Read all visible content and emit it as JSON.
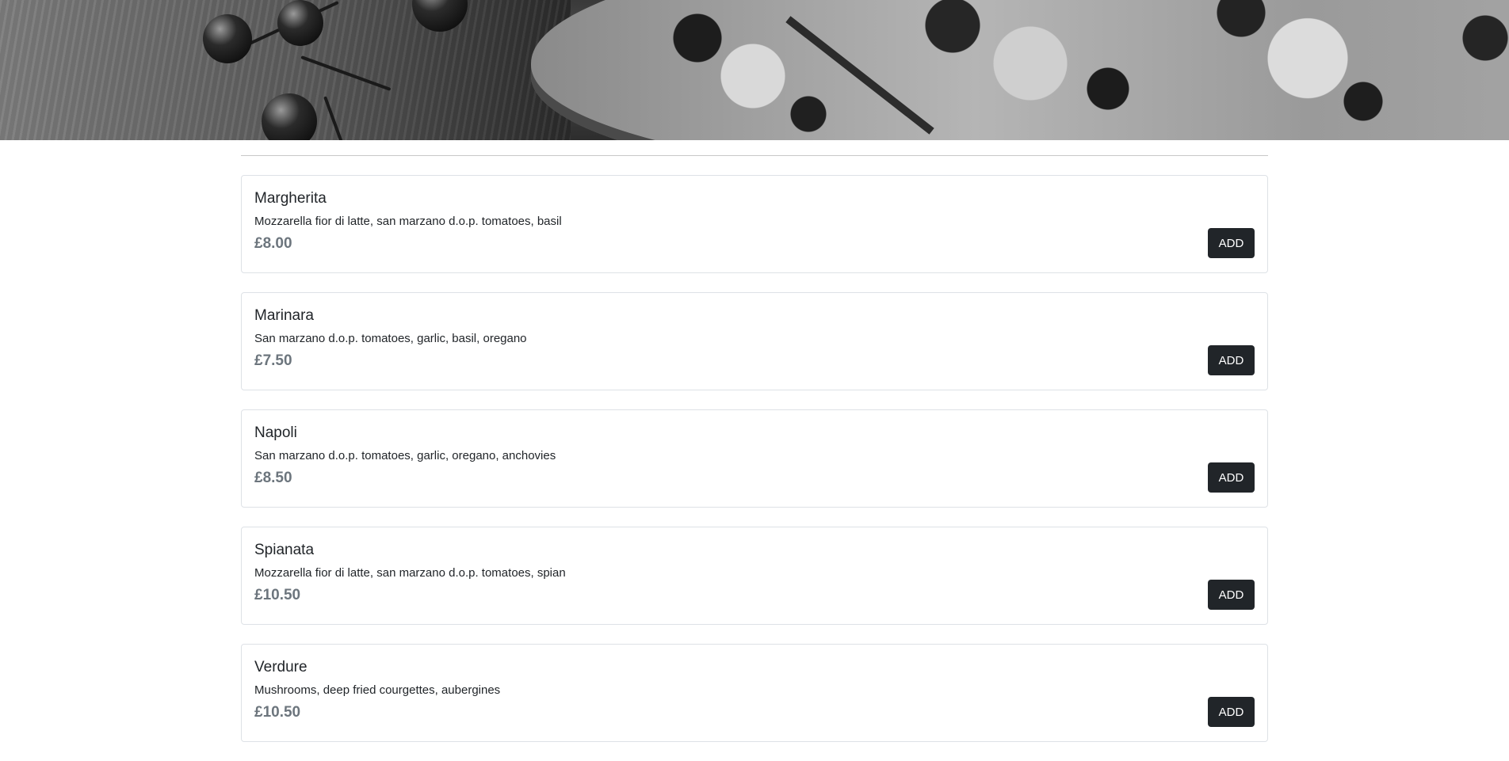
{
  "hero": {
    "image_name": "pizza-hero-photo"
  },
  "menu": {
    "items": [
      {
        "name": "Margherita",
        "description": "Mozzarella fior di latte, san marzano d.o.p. tomatoes, basil",
        "price": "£8.00",
        "button_label": "ADD"
      },
      {
        "name": "Marinara",
        "description": "San marzano d.o.p. tomatoes, garlic, basil, oregano",
        "price": "£7.50",
        "button_label": "ADD"
      },
      {
        "name": "Napoli",
        "description": "San marzano d.o.p. tomatoes, garlic, oregano, anchovies",
        "price": "£8.50",
        "button_label": "ADD"
      },
      {
        "name": "Spianata",
        "description": "Mozzarella fior di latte, san marzano d.o.p. tomatoes, spian",
        "price": "£10.50",
        "button_label": "ADD"
      },
      {
        "name": "Verdure",
        "description": "Mushrooms, deep fried courgettes, aubergines",
        "price": "£10.50",
        "button_label": "ADD"
      }
    ]
  },
  "colors": {
    "button_bg": "#212529",
    "price_text": "#6c757d",
    "card_border": "#dee2e6"
  }
}
